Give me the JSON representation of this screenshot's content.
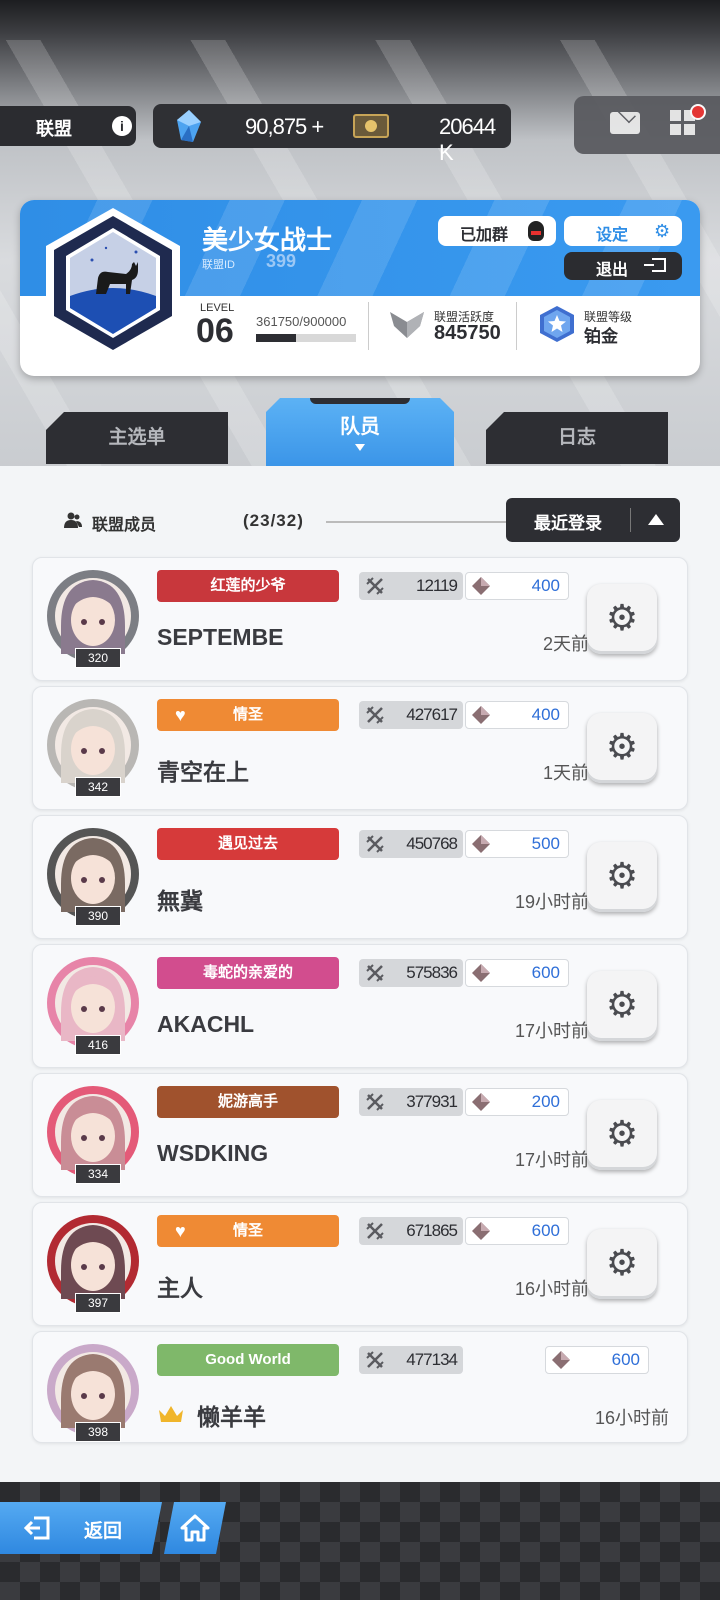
{
  "topbar": {
    "guild_label": "联盟",
    "gems": "90,875",
    "gems_plus": "+",
    "tickets": "20644 K"
  },
  "guild": {
    "name": "美少女战士",
    "id_label": "联盟ID",
    "id": "399",
    "joined_label": "已加群",
    "settings_label": "设定",
    "exit_label": "退出",
    "level_label": "LEVEL",
    "level": "06",
    "exp_text": "361750/900000",
    "exp_current": 361750,
    "exp_max": 900000,
    "activity_label": "联盟活跃度",
    "activity": "845750",
    "rank_label": "联盟等级",
    "rank": "铂金"
  },
  "tabs": {
    "main": "主选单",
    "members": "队员",
    "log": "日志"
  },
  "member_header": {
    "label": "联盟成员",
    "count": "(23/32)",
    "sort": "最近登录"
  },
  "members": [
    {
      "name": "SEPTEMBE",
      "level": "320",
      "title": "红莲的少爷",
      "power": "12119",
      "contribution": "400",
      "last_login": "2天前",
      "title_color": "#c8373c"
    },
    {
      "name": "青空在上",
      "level": "342",
      "title": "情圣",
      "power": "427617",
      "contribution": "400",
      "last_login": "1天前",
      "title_color": "#ef8a34"
    },
    {
      "name": "無冀",
      "level": "390",
      "title": "遇见过去",
      "power": "450768",
      "contribution": "500",
      "last_login": "19小时前",
      "title_color": "#d63a3a"
    },
    {
      "name": "AKACHL",
      "level": "416",
      "title": "毒蛇的亲爱的",
      "power": "575836",
      "contribution": "600",
      "last_login": "17小时前",
      "title_color": "#d24d8e"
    },
    {
      "name": "WSDKING",
      "level": "334",
      "title": "妮游高手",
      "power": "377931",
      "contribution": "200",
      "last_login": "17小时前",
      "title_color": "#a0522d"
    },
    {
      "name": "主人",
      "level": "397",
      "title": "情圣",
      "power": "671865",
      "contribution": "600",
      "last_login": "16小时前",
      "title_color": "#ef8a34"
    },
    {
      "name": "懒羊羊",
      "level": "398",
      "title": "Good World",
      "power": "477134",
      "contribution": "600",
      "last_login": "16小时前",
      "title_color": "#7fb86a"
    }
  ],
  "bottom": {
    "back_label": "返回"
  },
  "icons": [
    "info-icon",
    "gem-icon",
    "ticket-icon",
    "mail-icon",
    "menu-grid-icon",
    "qq-icon",
    "gear-icon",
    "exit-icon",
    "activity-icon",
    "rank-star-icon",
    "members-icon",
    "sword-icon",
    "diamond-icon",
    "crown-icon",
    "back-icon",
    "home-icon"
  ]
}
